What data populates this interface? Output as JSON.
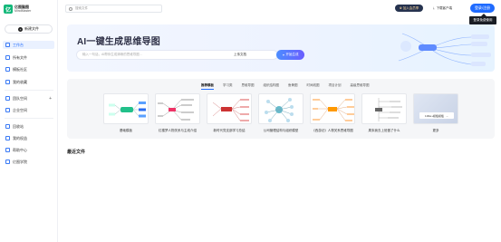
{
  "brand": {
    "logo_mark": "亿",
    "name_cn": "亿图脑图",
    "name_en": "MindMaster"
  },
  "sidebar": {
    "new_button": "新建文件",
    "items_top": [
      {
        "label": "工作台",
        "active": true,
        "icon": "workspace-icon"
      },
      {
        "label": "所有文件",
        "icon": "files-icon"
      },
      {
        "label": "模板社区",
        "icon": "template-icon"
      },
      {
        "label": "我的收藏",
        "icon": "star-icon"
      }
    ],
    "items_mid": [
      {
        "label": "团队空间",
        "icon": "team-icon",
        "has_add": true
      },
      {
        "label": "企业空间",
        "icon": "enterprise-icon"
      }
    ],
    "items_bottom": [
      {
        "label": "回收站",
        "icon": "trash-icon"
      },
      {
        "label": "我的权益",
        "icon": "rights-icon"
      },
      {
        "label": "帮助中心",
        "icon": "help-icon"
      },
      {
        "label": "亿图学院",
        "icon": "academy-icon"
      }
    ],
    "add_symbol": "+"
  },
  "topbar": {
    "search_placeholder": "搜索文件",
    "vip_label": "加入会员享",
    "download_label": "下载客户端",
    "login_label": "登录/注册",
    "tooltip": "登录免费使用"
  },
  "banner": {
    "title": "AI一键生成思维导图",
    "input_placeholder": "输入一句话，AI帮你生成清晰的思维导图...",
    "upload_label": "上传文档",
    "generate_label": "开始生成"
  },
  "templates": {
    "tabs": [
      "推荐模板",
      "学习类",
      "思维导图",
      "组织结构图",
      "鱼骨图",
      "时间线图",
      "项目计划",
      "高级思维导图"
    ],
    "active_tab": 0,
    "cards": [
      {
        "label": "基础模板"
      },
      {
        "label": "红楼梦人物关系与主线介绍"
      },
      {
        "label": "新时代党支部学习总结"
      },
      {
        "label": "公司管理结构与组织模型"
      },
      {
        "label": "《西游记》人物关系思维导图"
      },
      {
        "label": "周末我去上班做了什么"
      },
      {
        "label": "更多",
        "more": true,
        "more_button": "100w+模板模板"
      }
    ],
    "more_arrow": "→"
  },
  "recent_title": "最近文件",
  "colors": {
    "accent": "#1f6bff",
    "brand": "#14b87a",
    "vip_bg": "#26334f"
  }
}
